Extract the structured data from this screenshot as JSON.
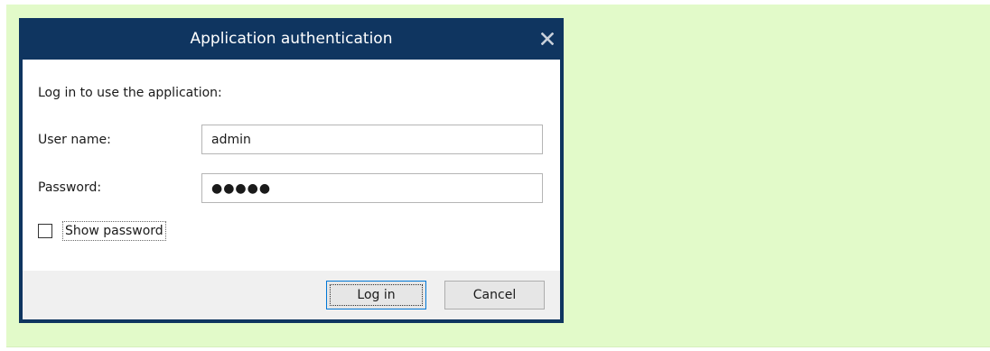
{
  "dialog": {
    "title": "Application authentication",
    "instruction": "Log in to use the application:",
    "username_label": "User name:",
    "username_value": "admin",
    "password_label": "Password:",
    "password_value": "●●●●●",
    "show_password_label": "Show password",
    "show_password_checked": false,
    "login_button": "Log in",
    "cancel_button": "Cancel"
  },
  "icons": {
    "close": "close-icon"
  },
  "colors": {
    "titlebar": "#0f3560",
    "backdrop": "#e2fac9",
    "footer": "#f0f0f0",
    "focus_border": "#0078d7"
  }
}
